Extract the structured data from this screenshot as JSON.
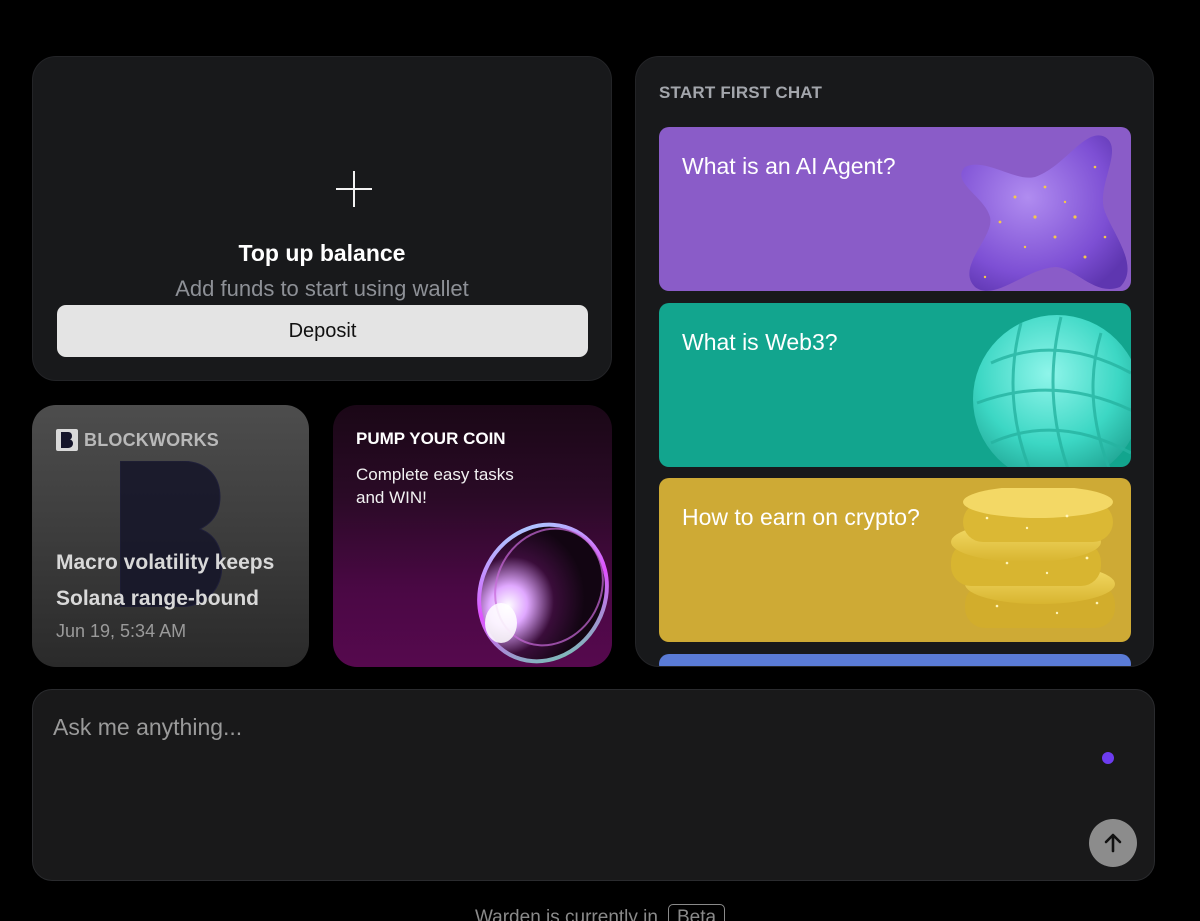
{
  "topup": {
    "title": "Top up balance",
    "subtitle": "Add funds to start using wallet",
    "deposit_label": "Deposit",
    "icon": "plus-icon"
  },
  "news": {
    "source": "BLOCKWORKS",
    "source_icon": "blockworks-logo",
    "headline": "Macro volatility keeps Solana range-bound",
    "time": "Jun 19, 5:34 AM"
  },
  "promo": {
    "title": "PUMP YOUR COIN",
    "description": "Complete easy tasks and WIN!",
    "image": "glossy-coin-ring"
  },
  "chat": {
    "title": "START FIRST CHAT",
    "prompts": [
      {
        "label": "What is an AI Agent?",
        "color": "#8a5cc8",
        "image": "purple-star-shape"
      },
      {
        "label": "What is Web3?",
        "color": "#12a58e",
        "image": "teal-sphere-shape"
      },
      {
        "label": "How to earn on crypto?",
        "color": "#ceaa35",
        "image": "gold-coin-stack"
      },
      {
        "label": "",
        "color": "#5a7bd6",
        "image": ""
      }
    ]
  },
  "ask": {
    "placeholder": "Ask me anything...",
    "send_icon": "arrow-up-icon",
    "accent": "#6d3cf0"
  },
  "footer": {
    "text": "Warden is currently in",
    "badge": "Beta"
  }
}
